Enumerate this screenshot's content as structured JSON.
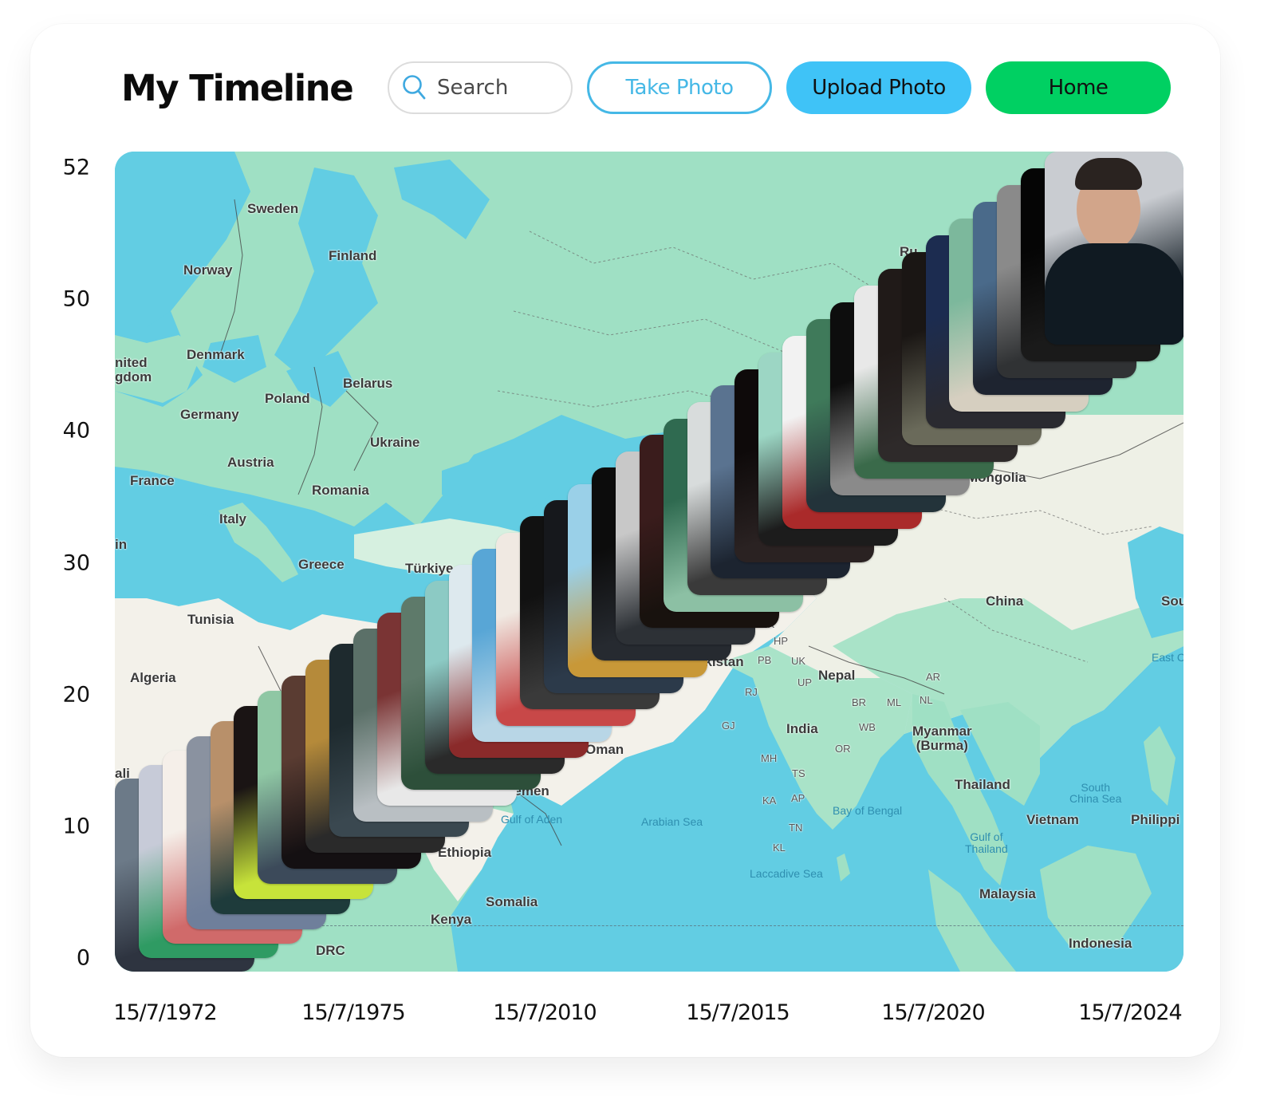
{
  "header": {
    "title": "My Timeline",
    "search_placeholder": "Search",
    "search_value": "",
    "take_photo_label": "Take Photo",
    "upload_photo_label": "Upload Photo",
    "home_label": "Home"
  },
  "colors": {
    "take_photo_border": "#45b8e6",
    "upload_photo_fill": "#3fc3f7",
    "home_fill": "#00d062",
    "search_icon": "#3fa9e0",
    "map_water": "#62cde3",
    "map_land": "#9fe0c4",
    "map_desert": "#f3f1ea"
  },
  "icons": {
    "search": "search-icon"
  },
  "chart_data": {
    "type": "scatter",
    "title": "My Timeline",
    "xlabel": "",
    "ylabel": "",
    "y_ticks": [
      "52",
      "50",
      "40",
      "30",
      "20",
      "10",
      "0"
    ],
    "x_ticks": [
      "15/7/1972",
      "15/7/1975",
      "15/7/2010",
      "15/7/2015",
      "15/7/2020",
      "15/7/2024"
    ],
    "ylim": [
      0,
      52
    ],
    "y_tick_values": [
      52,
      50,
      40,
      30,
      20,
      10,
      0
    ],
    "background": "world map (Europe, Africa, Asia)",
    "points_description": "photo thumbnails stacked diagonally, age rising with date",
    "photo_count": 38
  },
  "map_labels": [
    {
      "text": "Sweden",
      "kind": "country"
    },
    {
      "text": "Norway",
      "kind": "country"
    },
    {
      "text": "Finland",
      "kind": "country"
    },
    {
      "text": "nited\ngdom",
      "kind": "country"
    },
    {
      "text": "Denmark",
      "kind": "country"
    },
    {
      "text": "Belarus",
      "kind": "country"
    },
    {
      "text": "Poland",
      "kind": "country"
    },
    {
      "text": "Germany",
      "kind": "country"
    },
    {
      "text": "Ukraine",
      "kind": "country"
    },
    {
      "text": "Austria",
      "kind": "country"
    },
    {
      "text": "France",
      "kind": "country"
    },
    {
      "text": "Romania",
      "kind": "country"
    },
    {
      "text": "Italy",
      "kind": "country"
    },
    {
      "text": "in",
      "kind": "country"
    },
    {
      "text": "Greece",
      "kind": "country"
    },
    {
      "text": "Türkiye",
      "kind": "country"
    },
    {
      "text": "Tunisia",
      "kind": "country"
    },
    {
      "text": "Algeria",
      "kind": "country"
    },
    {
      "text": "ali",
      "kind": "country"
    },
    {
      "text": "Oman",
      "kind": "country"
    },
    {
      "text": "Yemen",
      "kind": "country"
    },
    {
      "text": "Gulf of Aden",
      "kind": "sea"
    },
    {
      "text": "Arabian Sea",
      "kind": "sea"
    },
    {
      "text": "Ethiopia",
      "kind": "country"
    },
    {
      "text": "Somalia",
      "kind": "country"
    },
    {
      "text": "Kenya",
      "kind": "country"
    },
    {
      "text": "DRC",
      "kind": "country"
    },
    {
      "text": "Mongolia",
      "kind": "country"
    },
    {
      "text": "Ru",
      "kind": "country"
    },
    {
      "text": "China",
      "kind": "country"
    },
    {
      "text": "Sou",
      "kind": "country"
    },
    {
      "text": "East C",
      "kind": "sea"
    },
    {
      "text": "akistan",
      "kind": "country"
    },
    {
      "text": "Nepal",
      "kind": "country"
    },
    {
      "text": "India",
      "kind": "country"
    },
    {
      "text": "Myanmar\n(Burma)",
      "kind": "country"
    },
    {
      "text": "Bay of Bengal",
      "kind": "sea"
    },
    {
      "text": "Laccadive Sea",
      "kind": "sea"
    },
    {
      "text": "Thailand",
      "kind": "country"
    },
    {
      "text": "South\nChina Sea",
      "kind": "sea"
    },
    {
      "text": "Vietnam",
      "kind": "country"
    },
    {
      "text": "Philippi",
      "kind": "country"
    },
    {
      "text": "Gulf of\nThailand",
      "kind": "sea"
    },
    {
      "text": "Malaysia",
      "kind": "country"
    },
    {
      "text": "Indonesia",
      "kind": "country"
    },
    {
      "text": "JK",
      "kind": "state"
    },
    {
      "text": "HP",
      "kind": "state"
    },
    {
      "text": "PB",
      "kind": "state"
    },
    {
      "text": "UK",
      "kind": "state"
    },
    {
      "text": "UP",
      "kind": "state"
    },
    {
      "text": "RJ",
      "kind": "state"
    },
    {
      "text": "BR",
      "kind": "state"
    },
    {
      "text": "GJ",
      "kind": "state"
    },
    {
      "text": "WB",
      "kind": "state"
    },
    {
      "text": "ML",
      "kind": "state"
    },
    {
      "text": "NL",
      "kind": "state"
    },
    {
      "text": "AR",
      "kind": "state"
    },
    {
      "text": "OR",
      "kind": "state"
    },
    {
      "text": "MH",
      "kind": "state"
    },
    {
      "text": "TS",
      "kind": "state"
    },
    {
      "text": "KA",
      "kind": "state"
    },
    {
      "text": "AP",
      "kind": "state"
    },
    {
      "text": "TN",
      "kind": "state"
    },
    {
      "text": "KL",
      "kind": "state"
    }
  ],
  "photos": [
    {
      "palette": [
        "#6c7a88",
        "#2e3440",
        "#c9a48a"
      ]
    },
    {
      "palette": [
        "#c7cbd8",
        "#2f9b63",
        "#e9d3c3"
      ]
    },
    {
      "palette": [
        "#f5efe9",
        "#d06a6a",
        "#b3a38f"
      ]
    },
    {
      "palette": [
        "#8a92a0",
        "#6f7f9b",
        "#d8c6a8"
      ]
    },
    {
      "palette": [
        "#b8906a",
        "#1e3b3b",
        "#c4a57e"
      ]
    },
    {
      "palette": [
        "#1a1414",
        "#c7e33a",
        "#d6b08e"
      ]
    },
    {
      "palette": [
        "#8fc7a4",
        "#3c4a5a",
        "#b88a70"
      ]
    },
    {
      "palette": [
        "#5a3c32",
        "#141012",
        "#c7936e"
      ]
    },
    {
      "palette": [
        "#b58a3a",
        "#2a2a2a",
        "#8fb3cc"
      ]
    },
    {
      "palette": [
        "#1e2a2e",
        "#3a4850",
        "#c09a82"
      ]
    },
    {
      "palette": [
        "#5b7068",
        "#b9bfc3",
        "#8a6c5c"
      ]
    },
    {
      "palette": [
        "#7a3434",
        "#e8e8e8",
        "#3c3c3c"
      ]
    },
    {
      "palette": [
        "#5e7a6a",
        "#2d4f3a",
        "#b7b7b7"
      ]
    },
    {
      "palette": [
        "#8ccac4",
        "#2a2a2a",
        "#cfa88a"
      ]
    },
    {
      "palette": [
        "#dde9ee",
        "#8a2a2a",
        "#e7d2b8"
      ]
    },
    {
      "palette": [
        "#58a6d6",
        "#b8d6e6",
        "#2c2c2c"
      ]
    },
    {
      "palette": [
        "#f0e9e2",
        "#c84848",
        "#4a4a4a"
      ]
    },
    {
      "palette": [
        "#111111",
        "#3a3a3a",
        "#9a8a7a"
      ]
    },
    {
      "palette": [
        "#16181c",
        "#2c3a4a",
        "#d6a47e"
      ]
    },
    {
      "palette": [
        "#9ad0e8",
        "#c89838",
        "#3b4a32"
      ]
    },
    {
      "palette": [
        "#0c0c0c",
        "#262a30",
        "#d63a4a"
      ]
    },
    {
      "palette": [
        "#c8c8c8",
        "#2d3136",
        "#8a8a8a"
      ]
    },
    {
      "palette": [
        "#3a1c1c",
        "#18120e",
        "#b07a5a"
      ]
    },
    {
      "palette": [
        "#2f6a50",
        "#8cc0a4",
        "#1a2a24"
      ]
    },
    {
      "palette": [
        "#d8dcdc",
        "#3a3a3a",
        "#c3a08a"
      ]
    },
    {
      "palette": [
        "#5a7390",
        "#1c2430",
        "#d4a088"
      ]
    },
    {
      "palette": [
        "#0e0a0a",
        "#2a2222",
        "#6c5050"
      ]
    },
    {
      "palette": [
        "#9cd6c4",
        "#1c1c1c",
        "#e6c2a4"
      ]
    },
    {
      "palette": [
        "#f2f2f2",
        "#aa2a2a",
        "#3a3a3a"
      ]
    },
    {
      "palette": [
        "#3f7a5a",
        "#23333a",
        "#b7b7b7"
      ]
    },
    {
      "palette": [
        "#0d0d0d",
        "#8a8a8a",
        "#ececec"
      ]
    },
    {
      "palette": [
        "#e8e8e8",
        "#3a6a4a",
        "#9a9a9a"
      ]
    },
    {
      "palette": [
        "#201a18",
        "#2e2a2a",
        "#c8a08a"
      ]
    },
    {
      "palette": [
        "#1a1614",
        "#6a6a5a",
        "#d8b89a"
      ]
    },
    {
      "palette": [
        "#1c2c50",
        "#2a2a30",
        "#d0a08a"
      ]
    },
    {
      "palette": [
        "#7cb89c",
        "#d6cfc0",
        "#2a2a2a"
      ]
    },
    {
      "palette": [
        "#4a6a8a",
        "#1e2430",
        "#c09a86"
      ]
    },
    {
      "palette": [
        "#8a8a8a",
        "#303234",
        "#d4b49e"
      ]
    },
    {
      "palette": [
        "#050505",
        "#1a1a1a",
        "#d03030"
      ]
    },
    {
      "palette": [
        "#c9ccd1",
        "#101a22",
        "#d2a58a"
      ]
    }
  ]
}
